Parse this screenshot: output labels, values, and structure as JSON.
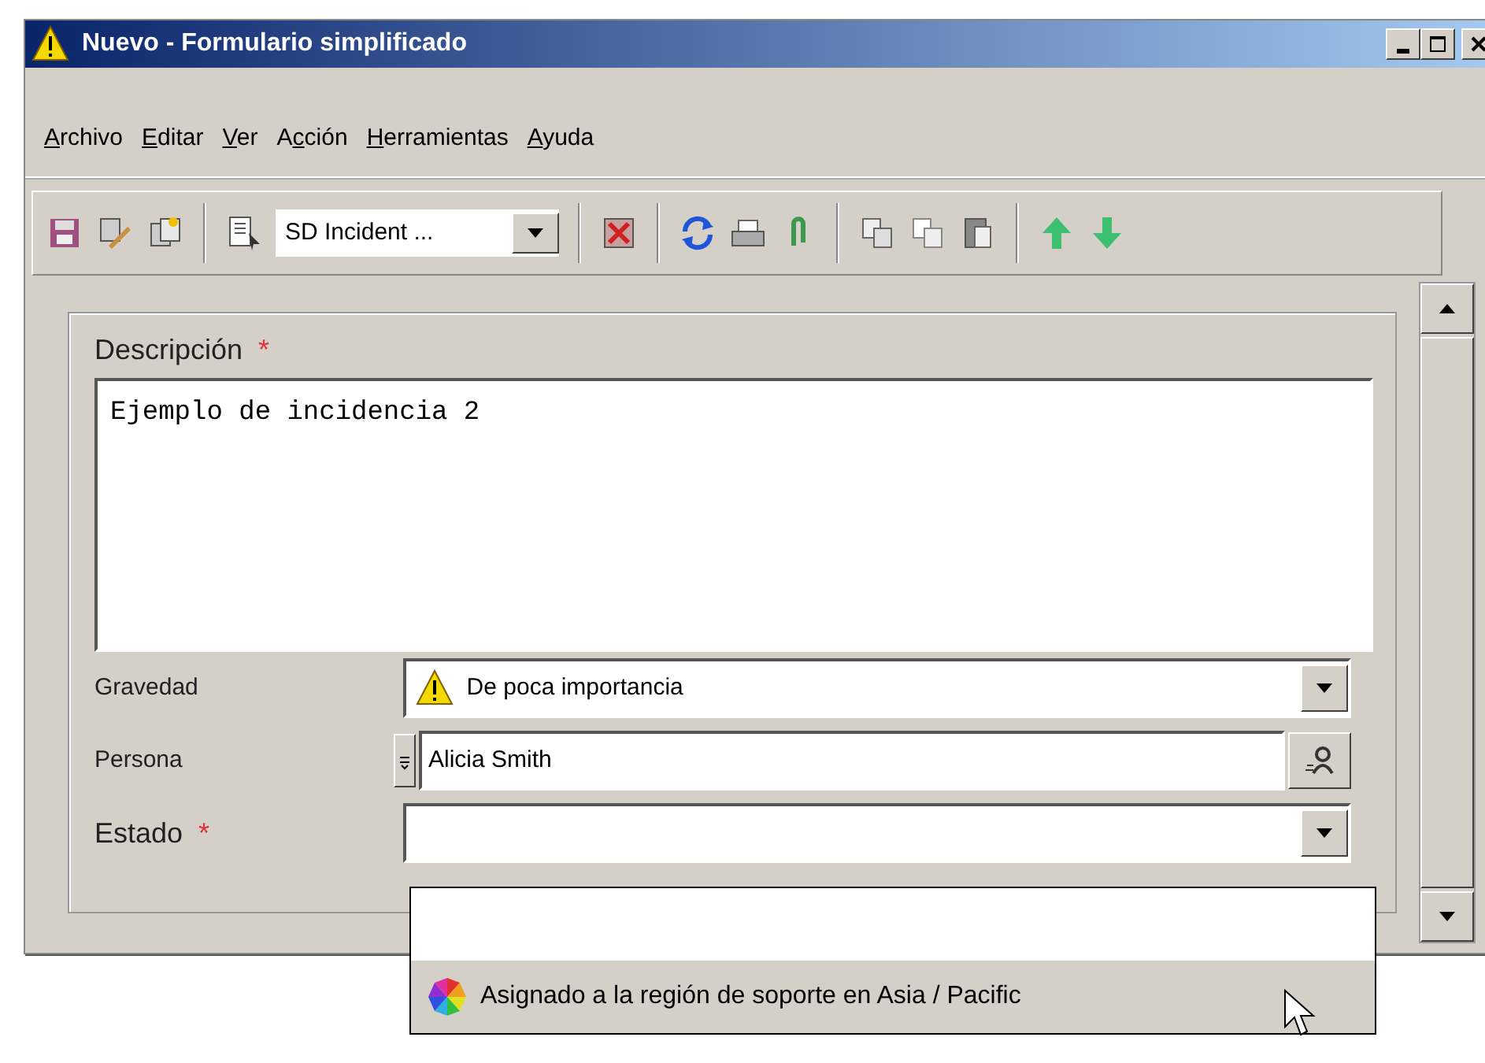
{
  "window": {
    "title": "Nuevo - Formulario simplificado"
  },
  "menu": [
    {
      "access_key": "A",
      "rest": "rchivo"
    },
    {
      "access_key": "E",
      "rest": "ditar"
    },
    {
      "access_key": "V",
      "rest": "er"
    },
    {
      "prefix": "A",
      "access_key": "c",
      "rest": "ción"
    },
    {
      "access_key": "H",
      "rest": "erramientas"
    },
    {
      "access_key": "A",
      "rest": "yuda"
    }
  ],
  "toolbar": {
    "form_selector": "SD Incident ..."
  },
  "fields": [
    {
      "kind": "textarea",
      "label": "Descripción",
      "required_mark": "*",
      "value": "Ejemplo de incidencia 2"
    },
    {
      "kind": "select",
      "label": "Gravedad",
      "value": "De poca importancia"
    },
    {
      "kind": "lookup",
      "label": "Persona",
      "value": "Alicia Smith"
    },
    {
      "kind": "select",
      "label": "Estado",
      "required_mark": "*",
      "expanded": true,
      "options": [
        {
          "label": "Asignado a la región de soporte en Asia / Pacific",
          "selected": true
        }
      ]
    }
  ]
}
